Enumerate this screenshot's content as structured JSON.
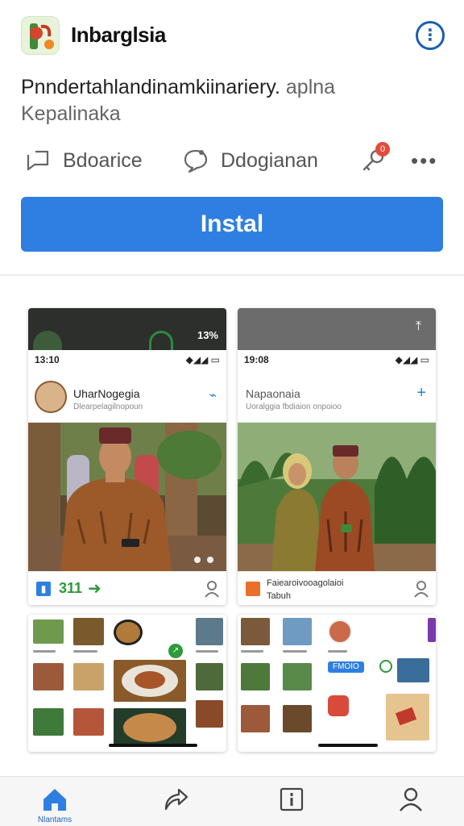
{
  "app": {
    "title": "Inbarglsia",
    "description_main": "Pnndertahlandinamkiinariery.",
    "description_muted": "aplna",
    "description_line2": "Kepalinaka"
  },
  "actions": {
    "share_label": "Bdoarice",
    "comment_label": "Ddogianan",
    "notification_count": "0",
    "more_label": "•••"
  },
  "install": {
    "label": "Instal"
  },
  "screenshots": [
    {
      "top_right": "13%",
      "status_time": "13:10",
      "status_icons": "◆◢◢ ▭",
      "profile_name": "UharNogegia",
      "profile_sub": "Dlearpelagilnopoun",
      "footer_text": "311"
    },
    {
      "status_time": "19:08",
      "status_icons": "◆◢◢ ▭",
      "profile_name": "Napaonaia",
      "profile_sub": "Uoralggia fbdiaion onpoioo",
      "footer_title": "Faiearoivooagolaioi",
      "footer_sub": "Tabuh"
    }
  ],
  "grid_cards": [
    {
      "badge": "↗"
    },
    {
      "chip": "FMOIO"
    }
  ],
  "bottom_nav": {
    "home_label": "Nlantams"
  },
  "colors": {
    "accent": "#2f7fe2",
    "info": "#1b5fb0",
    "badge": "#e24a3b"
  }
}
